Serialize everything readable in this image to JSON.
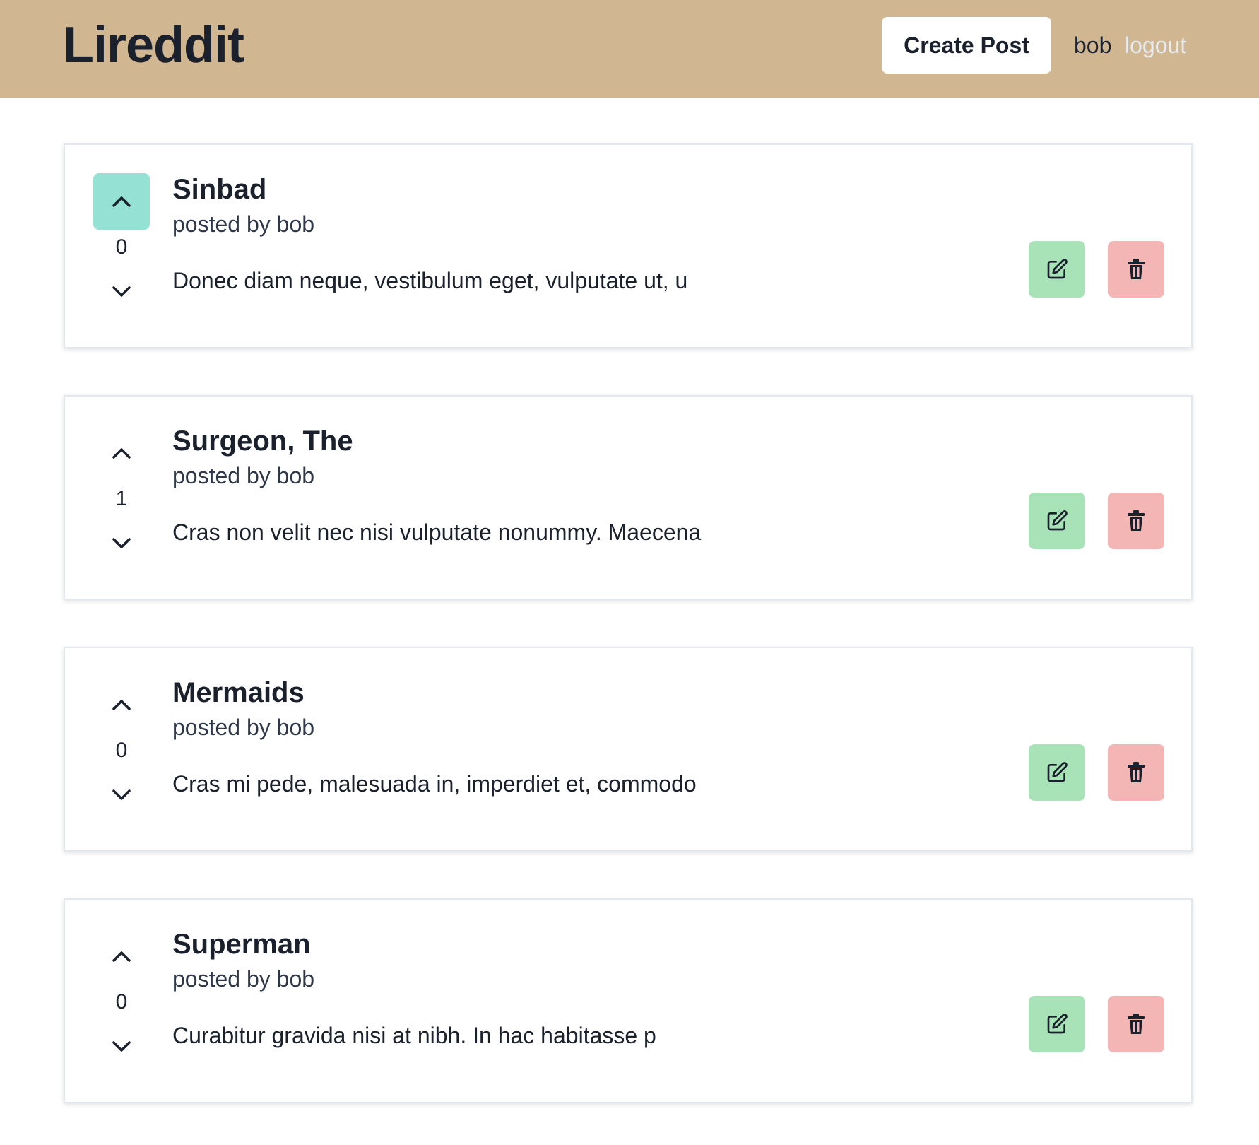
{
  "header": {
    "brand": "Lireddit",
    "create_post_label": "Create Post",
    "username": "bob",
    "logout_label": "logout",
    "background_color": "#d0b691"
  },
  "posts": [
    {
      "title": "Sinbad",
      "author_line": "posted by bob",
      "snippet": "Donec diam neque, vestibulum eget, vulputate ut, u",
      "points": "0",
      "upvoted": true
    },
    {
      "title": "Surgeon, The",
      "author_line": "posted by bob",
      "snippet": "Cras non velit nec nisi vulputate nonummy. Maecena",
      "points": "1",
      "upvoted": false
    },
    {
      "title": "Mermaids",
      "author_line": "posted by bob",
      "snippet": "Cras mi pede, malesuada in, imperdiet et, commodo",
      "points": "0",
      "upvoted": false
    },
    {
      "title": "Superman",
      "author_line": "posted by bob",
      "snippet": "Curabitur gravida nisi at nibh. In hac habitasse p",
      "points": "0",
      "upvoted": false
    }
  ],
  "icons": {
    "upvote": "chevron-up-icon",
    "downvote": "chevron-down-icon",
    "edit": "edit-icon",
    "delete": "trash-icon"
  },
  "colors": {
    "upvote_active": "#95e1d3",
    "edit_button": "#a8e3b8",
    "delete_button": "#f4b5b5"
  }
}
